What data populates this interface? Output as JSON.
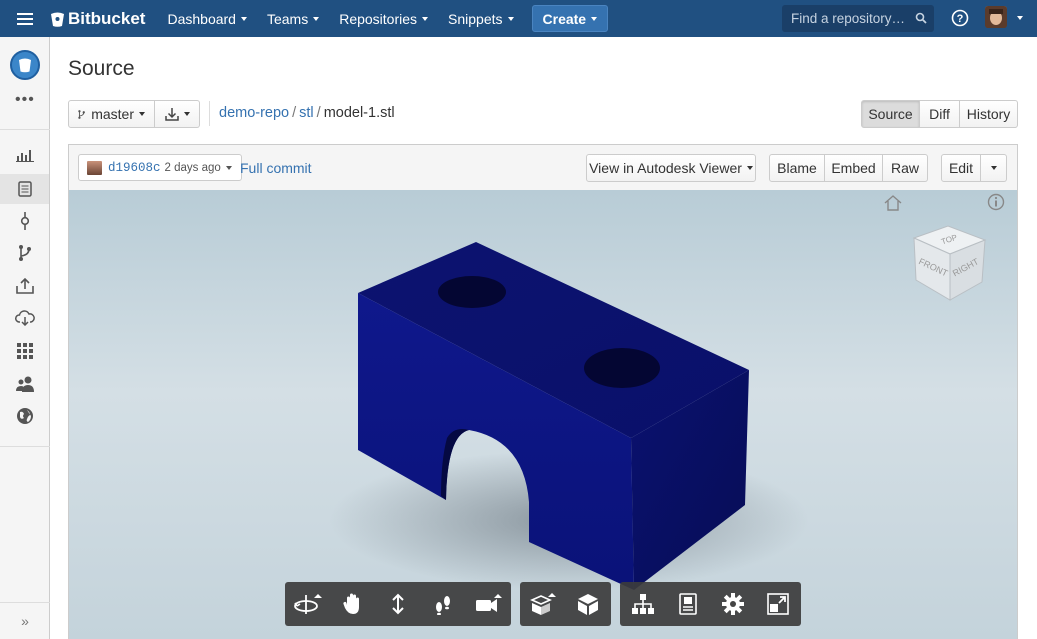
{
  "topbar": {
    "logo_text": "Bitbucket",
    "nav": [
      "Dashboard",
      "Teams",
      "Repositories",
      "Snippets"
    ],
    "create_label": "Create",
    "search_placeholder": "Find a repository…",
    "brand_color": "#205081"
  },
  "sidebar": {
    "icons": [
      "repo-avatar-icon",
      "more-dots-icon",
      "overview-icon",
      "source-icon",
      "commits-icon",
      "branches-icon",
      "pull-requests-icon",
      "downloads-icon",
      "apps-icon",
      "users-icon",
      "globe-icon"
    ],
    "expand_label": "»"
  },
  "page": {
    "title": "Source"
  },
  "source_bar": {
    "branch": "master",
    "breadcrumb": {
      "repo": "demo-repo",
      "dir": "stl",
      "file": "model-1.stl",
      "sep": "/"
    },
    "view_tabs": [
      "Source",
      "Diff",
      "History"
    ],
    "active_tab": "Source"
  },
  "file_header": {
    "commit_hash": "d19608c",
    "commit_age": "2 days ago",
    "full_commit_label": "Full commit",
    "viewer_label": "View in Autodesk Viewer",
    "actions": [
      "Blame",
      "Embed",
      "Raw"
    ],
    "edit_label": "Edit"
  },
  "viewer": {
    "viewcube_labels": [
      "TOP",
      "FRONT",
      "RIGHT"
    ],
    "model_color": "#0b1478",
    "toolbar_groups": [
      [
        "orbit-icon",
        "pan-icon",
        "zoom-icon",
        "first-person-icon",
        "camera-icon"
      ],
      [
        "explode-icon",
        "section-icon"
      ],
      [
        "model-browser-icon",
        "properties-icon",
        "settings-icon",
        "fullscreen-icon"
      ]
    ]
  }
}
